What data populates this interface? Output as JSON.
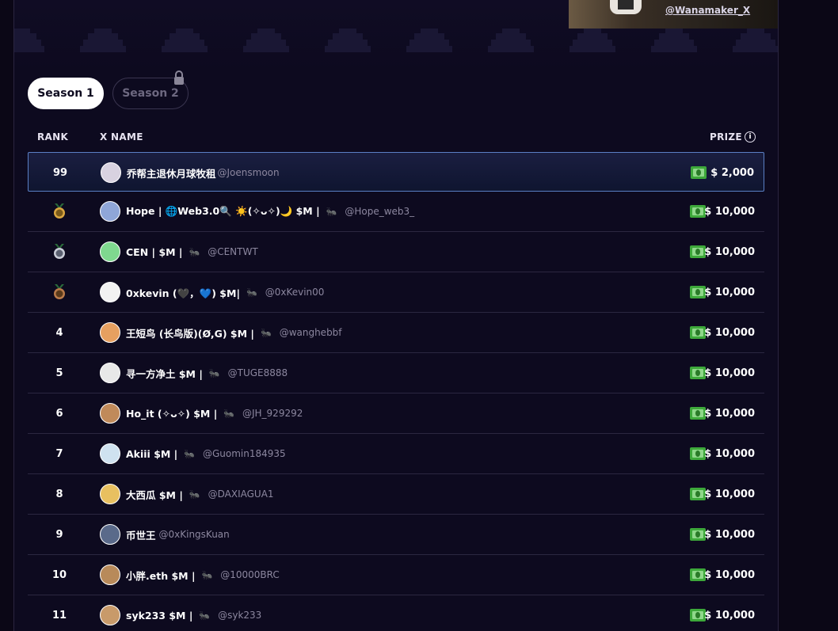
{
  "banner": {
    "handle": "@Wanamaker_X"
  },
  "tabs": [
    {
      "label": "Season 1",
      "active": true
    },
    {
      "label": "Season 2",
      "locked": true
    }
  ],
  "table": {
    "headers": {
      "rank": "RANK",
      "name": "X NAME",
      "prize": "PRIZE"
    },
    "rows": [
      {
        "rank": "99",
        "name": "乔帮主退休月球牧租",
        "handle": "@Joensmoon",
        "prize": "$ 2,000",
        "avatar": "#d8d2e0",
        "highlight": true
      },
      {
        "rank": "",
        "medal": "gold",
        "name": "Hope | 🌐Web3.0🔍 ☀️(✧ᴗ✧)🌙 $M |",
        "handle": "@Hope_web3_",
        "prize": "$ 10,000",
        "avatar": "#8fa6d8"
      },
      {
        "rank": "",
        "medal": "silver",
        "name": "CEN | $M |",
        "handle": "@CENTWT",
        "prize": "$ 10,000",
        "avatar": "#7fd88f"
      },
      {
        "rank": "",
        "medal": "bronze",
        "name": "0xkevin (🖤，💙) $M|",
        "handle": "@0xKevin00",
        "prize": "$ 10,000",
        "avatar": "#f2f2f2"
      },
      {
        "rank": "4",
        "name": "王短鸟 (长鸟版)(Ø,G) $M |",
        "handle": "@wanghebbf",
        "prize": "$ 10,000",
        "avatar": "#e6a060"
      },
      {
        "rank": "5",
        "name": "寻一方净土 $M |",
        "handle": "@TUGE8888",
        "prize": "$ 10,000",
        "avatar": "#e8e8e8"
      },
      {
        "rank": "6",
        "name": "Ho_it (✧ᴗ✧) $M |",
        "handle": "@JH_929292",
        "prize": "$ 10,000",
        "avatar": "#c08a5a"
      },
      {
        "rank": "7",
        "name": "Akiii $M |",
        "handle": "@Guomin184935",
        "prize": "$ 10,000",
        "avatar": "#cfe2f0"
      },
      {
        "rank": "8",
        "name": "大西瓜 $M |",
        "handle": "@DAXIAGUA1",
        "prize": "$ 10,000",
        "avatar": "#e8c060"
      },
      {
        "rank": "9",
        "name": "币世王",
        "handle": "@0xKingsKuan",
        "prize": "$ 10,000",
        "avatar": "#5a6a8a"
      },
      {
        "rank": "10",
        "name": "小胖.eth $M |",
        "handle": "@10000BRC",
        "prize": "$ 10,000",
        "avatar": "#b88a5a"
      },
      {
        "rank": "11",
        "name": "syk233 $M |",
        "handle": "@syk233",
        "prize": "$ 10,000",
        "avatar": "#c89a6a"
      }
    ]
  },
  "icons": {
    "ant": "ant-icon",
    "money": "money-icon",
    "lock": "lock-icon",
    "info": "info-icon"
  },
  "colors": {
    "background": "#0d0a1f",
    "highlight_border": "#5a7fc4",
    "muted": "#8c879f"
  }
}
